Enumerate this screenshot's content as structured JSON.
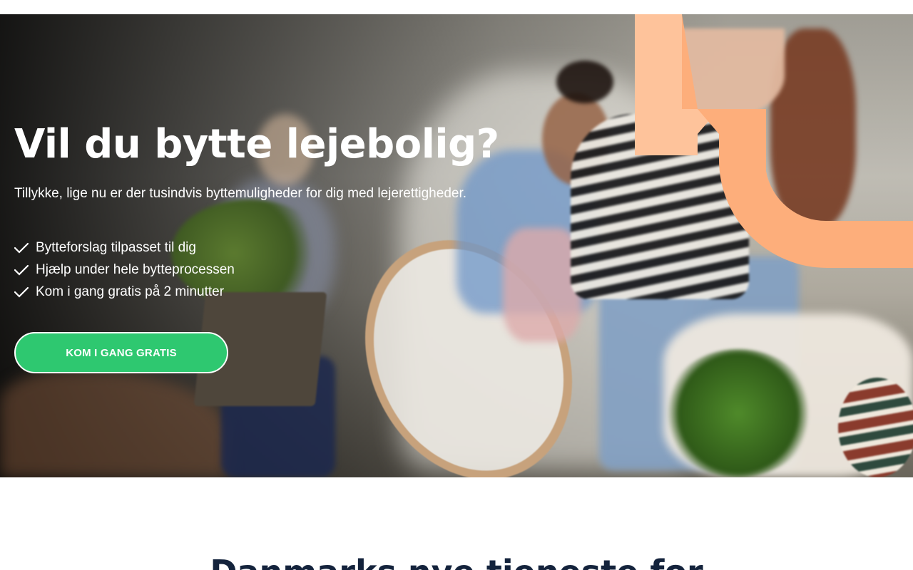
{
  "hero": {
    "title": "Vil du bytte lejebolig?",
    "subtitle": "Tillykke, lige nu er der tusindvis byttemuligheder for dig med lejerettigheder.",
    "features": [
      "Bytteforslag tilpasset til dig",
      "Hjælp under hele bytteprocessen",
      "Kom i gang gratis på 2 minutter"
    ],
    "cta_label": "KOM I GANG GRATIS"
  },
  "next_section": {
    "title": "Danmarks nye tjeneste for"
  },
  "colors": {
    "cta_green": "#2ec870",
    "brand_orange": "#fdae7b",
    "brand_orange_light": "#fec39b",
    "heading_navy": "#14233c"
  },
  "icons": {
    "feature_bullet": "check-icon"
  }
}
